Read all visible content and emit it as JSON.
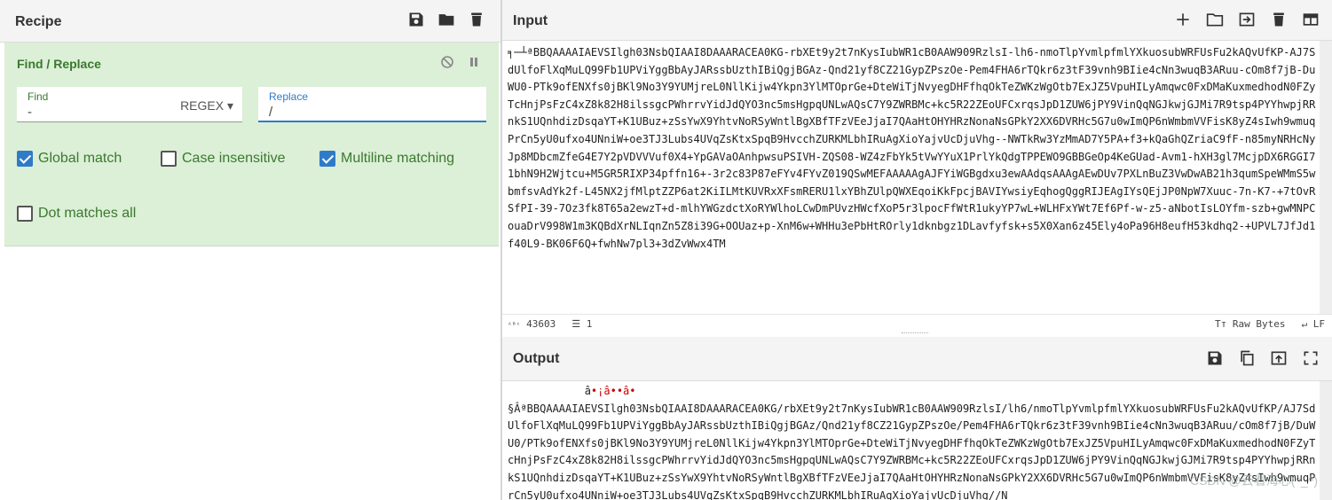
{
  "recipe": {
    "title": "Recipe",
    "operation": {
      "title": "Find / Replace",
      "find": {
        "label": "Find",
        "value": "-",
        "mode": "REGEX"
      },
      "replace": {
        "label": "Replace",
        "value": "/"
      },
      "options": [
        {
          "label": "Global match",
          "checked": true
        },
        {
          "label": "Case insensitive",
          "checked": false
        },
        {
          "label": "Multiline matching",
          "checked": true
        },
        {
          "label": "Dot matches all",
          "checked": false
        }
      ]
    }
  },
  "input": {
    "title": "Input",
    "text": "            ╕─┴ªBBQAAAAIAEVSIlgh03NsbQIAAI8DAAARACEA0KG-rbXEt9y2t7nKysIubWR1cB0AAW909RzlsI-lh6-nmoTlpYvmlpfmlYXkuosubWRFUsFu2kAQvUfKP-AJ7SdUlfoFlXqMuLQ99Fb1UPViYggBbAyJARssbUzthIBiQgjBGAz-Qnd21yf8CZ21GypZPszOe-Pem4FHA6rTQkr6z3tF39vnh9BIie4cNn3wuqB3ARuu-cOm8f7jB-DuWU0-PTk9ofENXfs0jBKl9No3Y9YUMjreL0NllKijw4Ykpn3YlMTOprGe+DteWiTjNvyegDHFfhqOkTeZWKzWgOtb7ExJZ5VpuHILyAmqwc0FxDMaKuxmedhodN0FZyTcHnjPsFzC4xZ8k82H8ilssgcPWhrrvYidJdQYO3nc5msHgpqUNLwAQsC7Y9ZWRBMc+kc5R22ZEoUFCxrqsJpD1ZUW6jPY9VinQqNGJkwjGJMi7R9tsp4PYYhwpjRRnkS1UQnhdizDsqaYT+K1UBuz+zSsYwX9YhtvNoRSyWntlBgXBfTFzVEeJjaI7QAaHtOHYHRzNonaNsGPkY2XX6DVRHc5G7u0wImQP6nWmbmVVFisK8yZ4sIwh9wmuqPrCn5yU0ufxo4UNniW+oe3TJ3Lubs4UVqZsKtxSpqB9HvcchZURKMLbhIRuAgXioYajvUcDjuVhg--NWTkRw3YzMmAD7Y5PA+f3+kQaGhQZriaC9fF-n85myNRHcNyJp8MDbcmZfeG4E7Y2pVDVVVuf0X4+YpGAVaOAnhpwsuPSIVH-ZQS08-WZ4zFbYk5tVwYYuX1PrlYkQdgTPPEWO9GBBGeOp4KeGUad-Avm1-hXH3gl7McjpDX6RGGI71bhN9H2Wjtcu+M5GR5RIXP34pffn16+-3r2c83P87eFYv4FYvZ019QSwMEFAAAAAgAJFYiWGBgdxu3ewAAdqsAAAgAEwDUv7PXLnBuZ3VwDwAB21h3qumSpeWMmS5wbmfsvAdYk2f-L45NX2jfMlptZZP6at2KiILMtKUVRxXFsmRERU1lxYBhZUlpQWXEqoiKkFpcjBAVIYwsiyEqhogQggRIJEAgIYsQEjJP0NpW7Xuuc-7n-K7-+7tOvRSfPI-39-7Oz3fk8T65a2ewzT+d-mlhYWGzdctXoRYWlhoLCwDmPUvzHWcfXoP5r3lpocFfWtR1ukyYP7wL+WLHFxYWt7Ef6Pf-w-z5-aNbotIsLOYfm-szb+gwMNPCouaDrV998W1m3KQBdXrNLIqnZn5Z8i39G+OOUaz+p-XnM6w+WHHu3ePbHtROrly1dknbgz1DLavfyfsk+s5X0Xan6z45Ely4oPa96H8eufH53kdhq2-+UPVL7JfJd1f40L9-BK06F6Q+fwhNw7pl3+3dZvWwx4TM",
    "status_chars": "43603",
    "status_lines": "1",
    "status_enc": "Raw Bytes",
    "status_eol": "LF"
  },
  "output": {
    "title": "Output",
    "line1_prefix": "            â",
    "line1_marks": "•¡â••â•",
    "text": "§ÂªBBQAAAAIAEVSIlgh03NsbQIAAI8DAAARACEA0KG/rbXEt9y2t7nKysIubWR1cB0AAW909RzlsI/lh6/nmoTlpYvmlpfmlYXkuosubWRFUsFu2kAQvUfKP/AJ7SdUlfoFlXqMuLQ99Fb1UPViYggBbAyJARssbUzthIBiQgjBGAz/Qnd21yf8CZ21GypZPszOe/Pem4FHA6rTQkr6z3tF39vnh9BIie4cNn3wuqB3ARuu/cOm8f7jB/DuWU0/PTk9ofENXfs0jBKl9No3Y9YUMjreL0NllKijw4Ykpn3YlMTOprGe+DteWiTjNvyegDHFfhqOkTeZWKzWgOtb7ExJZ5VpuHILyAmqwc0FxDMaKuxmedhodN0FZyTcHnjPsFzC4xZ8k82H8ilssgcPWhrrvYidJdQYO3nc5msHgpqUNLwAQsC7Y9ZWRBMc+kc5R22ZEoUFCxrqsJpD1ZUW6jPY9VinQqNGJkwjGJMi7R9tsp4PYYhwpjRRnkS1UQnhdizDsqaYT+K1UBuz+zSsYwX9YhtvNoRSyWntlBgXBfTFzVEeJjaI7QAaHtOHYHRzNonaNsGPkY2XX6DVRHc5G7u0wImQP6nWmbmVVFisK8yZ4sIwh9wmuqPrCn5yU0ufxo4UNniW+oe3TJ3Lubs4UVqZsKtxSpqB9HvcchZURKMLbhIRuAgXioYajvUcDjuVhg//N",
    "watermark": "CSDN @云看海心(^_^)"
  },
  "icons": [
    "save-icon",
    "folder-icon",
    "trash-icon",
    "plus-icon",
    "open-folder-icon",
    "import-icon",
    "layout-icon",
    "copy-icon",
    "upload-icon",
    "fullscreen-icon",
    "disable-icon",
    "pause-icon"
  ]
}
